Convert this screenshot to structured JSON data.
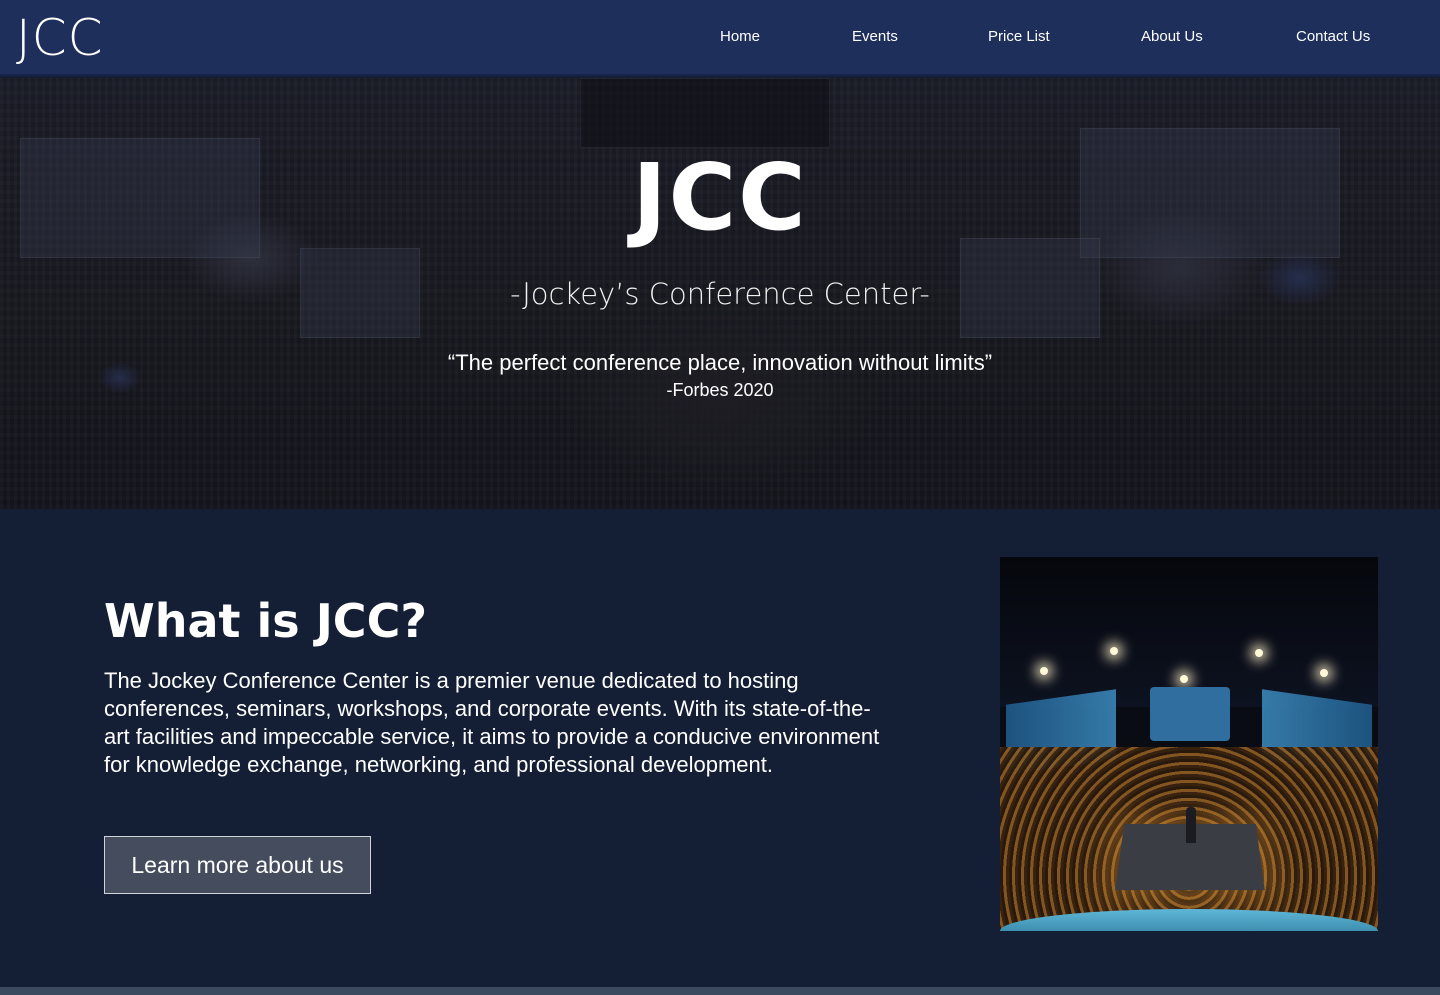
{
  "nav": {
    "logo": "JCC",
    "links": [
      {
        "label": "Home"
      },
      {
        "label": "Events"
      },
      {
        "label": "Price List"
      },
      {
        "label": "About Us"
      },
      {
        "label": "Contact Us"
      }
    ]
  },
  "hero": {
    "title": "JCC",
    "subtitle": "-Jockey’s Conference Center-",
    "quote": "“The perfect conference place, innovation without limits”",
    "quote_source": "-Forbes 2020"
  },
  "about": {
    "heading": "What is JCC?",
    "text": "The Jockey Conference Center is a premier venue dedicated to hosting conferences, seminars, workshops, and corporate events. With its state-of-the-art facilities and impeccable service, it aims to provide a conducive environment for knowledge exchange, networking, and professional development.",
    "button_label": "Learn more about us"
  },
  "colors": {
    "navbar": "#1f2f5c",
    "page_background": "#141e34",
    "button_background": "#454c5e"
  }
}
